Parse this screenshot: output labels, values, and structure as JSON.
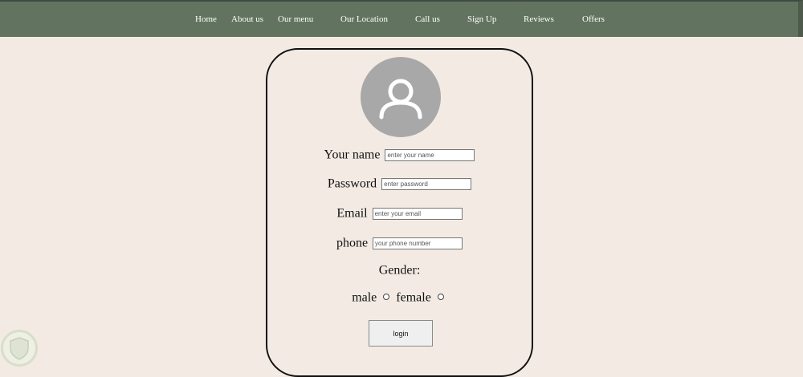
{
  "nav": {
    "items": [
      {
        "label": "Home"
      },
      {
        "label": "About us"
      },
      {
        "label": "Our menu"
      },
      {
        "label": "Our Location"
      },
      {
        "label": "Call us"
      },
      {
        "label": "Sign Up"
      },
      {
        "label": "Reviews"
      },
      {
        "label": "Offers"
      }
    ]
  },
  "form": {
    "avatar_icon": "user-icon",
    "name": {
      "label": "Your name",
      "placeholder": "enter your name",
      "value": ""
    },
    "password": {
      "label": "Password",
      "placeholder": "enter password",
      "value": ""
    },
    "email": {
      "label": "Email",
      "placeholder": "enter your email",
      "value": ""
    },
    "phone": {
      "label": "phone",
      "placeholder": "your phone number",
      "value": ""
    },
    "gender": {
      "label": "Gender:",
      "options": [
        {
          "label": "male",
          "selected": false
        },
        {
          "label": "female",
          "selected": false
        }
      ]
    },
    "submit_label": "login"
  },
  "badge_icon": "shield-icon",
  "colors": {
    "nav_bg": "#62745f",
    "page_bg": "#f3ebe3",
    "avatar_bg": "#a8a8a8"
  }
}
